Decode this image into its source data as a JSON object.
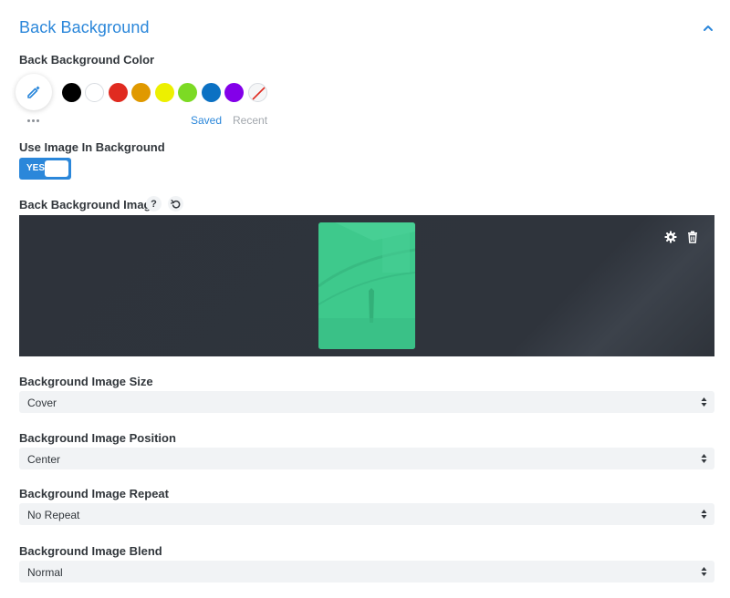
{
  "section": {
    "title": "Back Background"
  },
  "color": {
    "label": "Back Background Color",
    "swatches": [
      {
        "name": "black",
        "hex": "#000000"
      },
      {
        "name": "white",
        "hex": "#ffffff"
      },
      {
        "name": "red",
        "hex": "#e02b20"
      },
      {
        "name": "orange",
        "hex": "#e09900"
      },
      {
        "name": "yellow",
        "hex": "#edf000"
      },
      {
        "name": "green",
        "hex": "#7cda24"
      },
      {
        "name": "blue",
        "hex": "#0c71c3"
      },
      {
        "name": "purple",
        "hex": "#8300e9"
      },
      {
        "name": "none",
        "hex": "transparent"
      }
    ],
    "tabs": {
      "saved": "Saved",
      "recent": "Recent"
    },
    "accent": "#2b87da"
  },
  "use_image": {
    "label": "Use Image In Background",
    "toggle": "YES"
  },
  "image": {
    "label": "Back Background Image",
    "help": "?",
    "thumb_color": "#3ec98c"
  },
  "fields": {
    "size": {
      "label": "Background Image Size",
      "value": "Cover"
    },
    "position": {
      "label": "Background Image Position",
      "value": "Center"
    },
    "repeat": {
      "label": "Background Image Repeat",
      "value": "No Repeat"
    },
    "blend": {
      "label": "Background Image Blend",
      "value": "Normal"
    }
  }
}
